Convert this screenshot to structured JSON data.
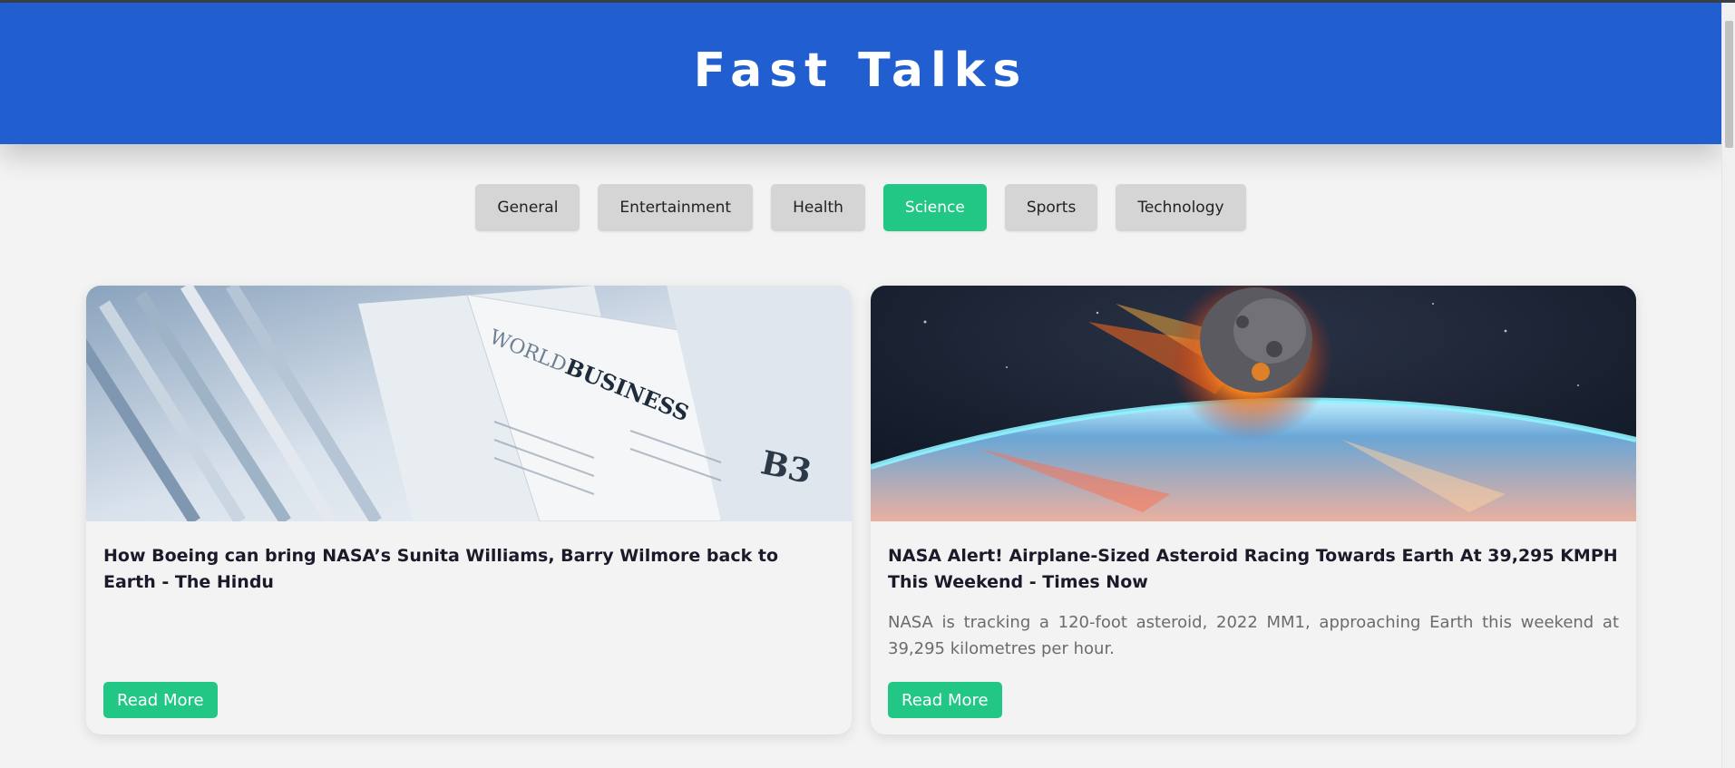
{
  "header": {
    "title": "Fast Talks"
  },
  "categories": [
    "General",
    "Entertainment",
    "Health",
    "Science",
    "Sports",
    "Technology"
  ],
  "active_category": "Science",
  "articles": [
    {
      "title": "How Boeing can bring NASA’s Sunita Williams, Barry Wilmore back to Earth - The Hindu",
      "description": "",
      "image_icon": "newspaper-image",
      "button_label": "Read More"
    },
    {
      "title": "NASA Alert! Airplane-Sized Asteroid Racing Towards Earth At 39,295 KMPH This Weekend - Times Now",
      "description": "NASA is tracking a 120-foot asteroid, 2022 MM1, approaching Earth this weekend at 39,295 kilometres per hour.",
      "image_icon": "asteroid-earth-image",
      "button_label": "Read More"
    }
  ],
  "image_text": {
    "world": "WORLD",
    "business": "BUSINESS",
    "code": "B3"
  },
  "colors": {
    "header": "#215fd1",
    "accent": "#22c786",
    "tab": "#d5d5d5"
  }
}
